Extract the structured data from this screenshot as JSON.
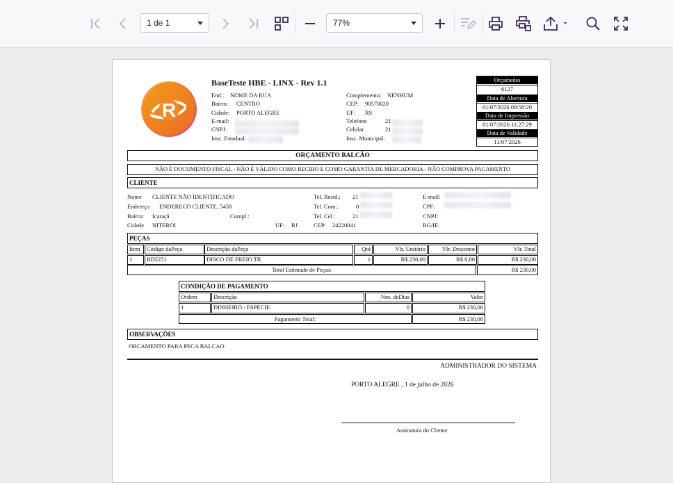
{
  "toolbar": {
    "page_select": "1 de 1",
    "zoom_select": "77%"
  },
  "report": {
    "company": "BaseTeste HBE - LINX - Rev 1.1",
    "logo_letter": "R",
    "left_fields": [
      {
        "label": "End.:",
        "value": "NOME DA RUA"
      },
      {
        "label": "Bairro:",
        "value": "CENTRO"
      },
      {
        "label": "Cidade:",
        "value": "PORTO ALEGRE"
      },
      {
        "label": "E-mail:",
        "value": ""
      },
      {
        "label": "CNPJ:",
        "value": ""
      },
      {
        "label": "Insc. Estadual:",
        "value": ""
      }
    ],
    "right_fields": [
      {
        "label": "Complemento:",
        "value": "NENHUM"
      },
      {
        "label": "CEP:",
        "value": "90570020"
      },
      {
        "label": "UF:",
        "value": "RS"
      },
      {
        "label": "Telefone",
        "value": "21"
      },
      {
        "label": "Celular",
        "value": "21"
      },
      {
        "label": "Insc. Municipal:",
        "value": ""
      }
    ],
    "header_box": {
      "orcamento_label": "Orçamento",
      "orcamento_value": "6127",
      "abertura_label": "Data de Abertura",
      "abertura_value": "01/07/2026 09:58:20",
      "impressao_label": "Data de Impressão",
      "impressao_value": "01/07/2026 11:27:29",
      "validade_label": "Data de Validade",
      "validade_value": "11/07/2026"
    },
    "title": "ORÇAMENTO BALCÃO",
    "disclaimer": "NÃO É DOCUMENTO FISCAL - NÃO É VÁLIDO COMO RECIBO E COMO GARANTIA DE MERCADORIA - NÃO COMPROVA PAGAMENTO",
    "cliente": {
      "section_title": "CLIENTE",
      "nome_label": "Nome",
      "nome": "CLIENTE NÃO IDENTIFICADO",
      "endereco_label": "Endereço",
      "endereco": "ENDERECO CLIENTE, 5458",
      "bairro_label": "Bairro:",
      "bairro": "Icaraçã",
      "compl_label": "Compl.:",
      "cidade_label": "Cidade",
      "cidade": "NITEROI",
      "uf_label": "UF:",
      "uf": "RJ",
      "cep_label": "CEP:",
      "cep": "24220041",
      "tel_resid_label": "Tel. Resid.:",
      "tel_resid": "21",
      "tel_com_label": "Tel. Com.:",
      "tel_com": "0",
      "tel_cel_label": "Tel. Cel.:",
      "tel_cel": "21",
      "email_label": "E-mail:",
      "cpf_label": "CPF:",
      "cnpj_label": "CNPJ:",
      "rgie_label": "RG/IE:"
    },
    "pecas": {
      "section_title": "PEÇAS",
      "columns": [
        "Item",
        "Código daPeça",
        "Descrição daPeça",
        "Qtd",
        "Vlr. Unitário",
        "Vlr. Desconto",
        "Vlr. Total"
      ],
      "rows": [
        [
          "1",
          "BD2251",
          "DISCO DE FREIO TR",
          "1",
          "R$ 230,00",
          "R$ 0,00",
          "R$ 230,00"
        ]
      ],
      "total_label": "Total Estimado de Peças:",
      "total_value": "R$ 230,00"
    },
    "pagamento": {
      "section_title": "CONDIÇÃO DE PAGAMENTO",
      "columns": [
        "Ordem",
        "Descrição",
        "Nro. deDias",
        "Valor"
      ],
      "rows": [
        [
          "1",
          "DINHEIRO / ESPECIE",
          "0",
          "R$ 230,00"
        ]
      ],
      "total_label": "Pagamento Total:",
      "total_value": "R$ 230,00"
    },
    "observacoes": {
      "section_title": "OBSERVAÇÕES",
      "text": "ORCAMENTO PARA PECA BALCAO"
    },
    "admin": "ADMINISTRADOR DO SISTEMA",
    "place_date": "PORTO ALEGRE ,  1 de julho de 2026",
    "signature_label": "Assinatura do Cliente"
  }
}
